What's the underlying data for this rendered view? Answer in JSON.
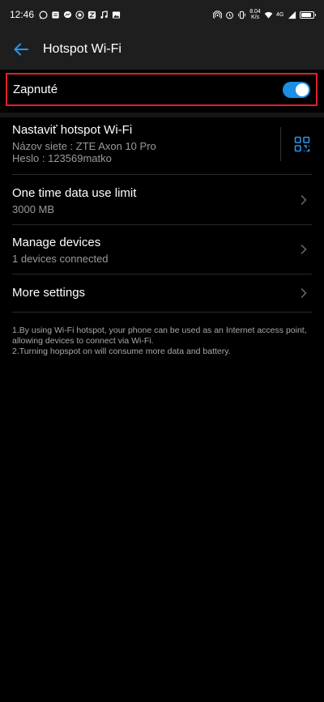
{
  "status_bar": {
    "time": "12:46",
    "left_icons": [
      "whatsapp-icon",
      "sim-card-icon",
      "messenger-icon",
      "notification-badge-icon",
      "z-app-icon",
      "music-note-icon",
      "image-icon"
    ],
    "net_speed": "8.04",
    "net_speed_unit": "K/s",
    "network_label": "4G",
    "right_icons": [
      "hotspot-icon",
      "alarm-icon",
      "vibrate-icon",
      "wifi-icon",
      "signal-icon",
      "battery-icon"
    ]
  },
  "app_bar": {
    "title": "Hotspot Wi-Fi",
    "back_icon": "back-arrow-icon"
  },
  "toggle": {
    "label": "Zapnuté",
    "state": "on",
    "accent": "#1a8fe3",
    "highlight_border": "#e0202c"
  },
  "settings": {
    "configure": {
      "title": "Nastaviť hotspot Wi-Fi",
      "network_line": "Názov siete : ZTE Axon 10 Pro",
      "password_line": "Heslo : 123569matko",
      "icon": "qr-code-icon"
    },
    "data_limit": {
      "title": "One time data use limit",
      "value": "3000 MB"
    },
    "manage_devices": {
      "title": "Manage devices",
      "value": "1 devices connected"
    },
    "more_settings": {
      "title": "More settings"
    }
  },
  "notes": {
    "line1": "1.By using Wi-Fi hotspot, your phone can be used as an Internet access point, allowing devices to connect via Wi-Fi.",
    "line2": "2.Turning hopspot on will consume more data and battery."
  },
  "battery_level_percent": 85
}
